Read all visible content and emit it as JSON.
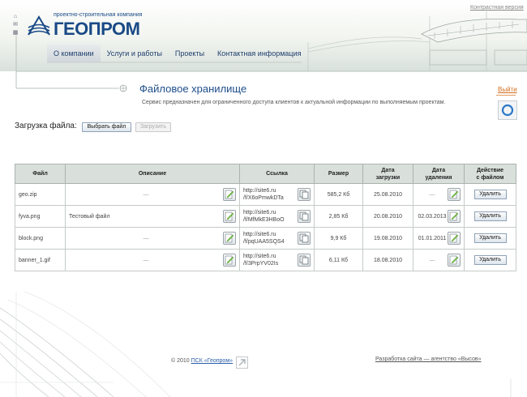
{
  "header": {
    "company_tagline": "проектно-строительная компания",
    "company_name": "ГЕОПРОМ",
    "contrast_link": "Контрастная версия",
    "utility_icons": [
      "home-icon",
      "mail-icon",
      "sitemap-icon"
    ],
    "nav": [
      {
        "label": "О компании",
        "active": true
      },
      {
        "label": "Услуги и работы",
        "active": false
      },
      {
        "label": "Проекты",
        "active": false
      },
      {
        "label": "Контактная информация",
        "active": false
      }
    ]
  },
  "page": {
    "title": "Файловое хранилище",
    "description": "Сервис предназначен для ограниченного доступа клиентов к актуальной информации по выполняемым проектам.",
    "exit_label": "Выйти"
  },
  "upload": {
    "label": "Загрузка файла:",
    "choose_button": "Выбрать файл",
    "upload_button": "Загрузить"
  },
  "table": {
    "headers": [
      "Файл",
      "Описание",
      "Ссылка",
      "Размер",
      "Дата\nзагрузки",
      "Дата\nудаления",
      "Действие\nс файлом"
    ],
    "rows": [
      {
        "file": "geo.zip",
        "description": "—",
        "link1": "http://site6.ru",
        "link2": "/f/X6oPmwkDTa",
        "size": "585,2 Кб",
        "uploaded": "25.08.2010",
        "deleted": "—",
        "action": "Удалить"
      },
      {
        "file": "fyva.png",
        "description": "Тестовый файл",
        "link1": "http://site6.ru",
        "link2": "/f/MfMkE3HBoO",
        "size": "2,85 Кб",
        "uploaded": "20.08.2010",
        "deleted": "02.03.2013",
        "action": "Удалить"
      },
      {
        "file": "block.png",
        "description": "—",
        "link1": "http://site6.ru",
        "link2": "/f/pqUAA5SQS4",
        "size": "9,9 Кб",
        "uploaded": "19.08.2010",
        "deleted": "01.01.2011",
        "action": "Удалить"
      },
      {
        "file": "banner_1.gif",
        "description": "—",
        "link1": "http://site6.ru",
        "link2": "/f/3PrpYV02Is",
        "size": "6,11 Кб",
        "uploaded": "18.08.2010",
        "deleted": "—",
        "action": "Удалить"
      }
    ]
  },
  "footer": {
    "copyright_prefix": "© 2010",
    "copyright_link": "ПСК «Геопром»",
    "developer_link": "Разработка сайта — агентство «Высов»"
  },
  "colors": {
    "brand": "#1a4a86",
    "table_header": "#d9e0db",
    "exit": "#d36b1c"
  }
}
